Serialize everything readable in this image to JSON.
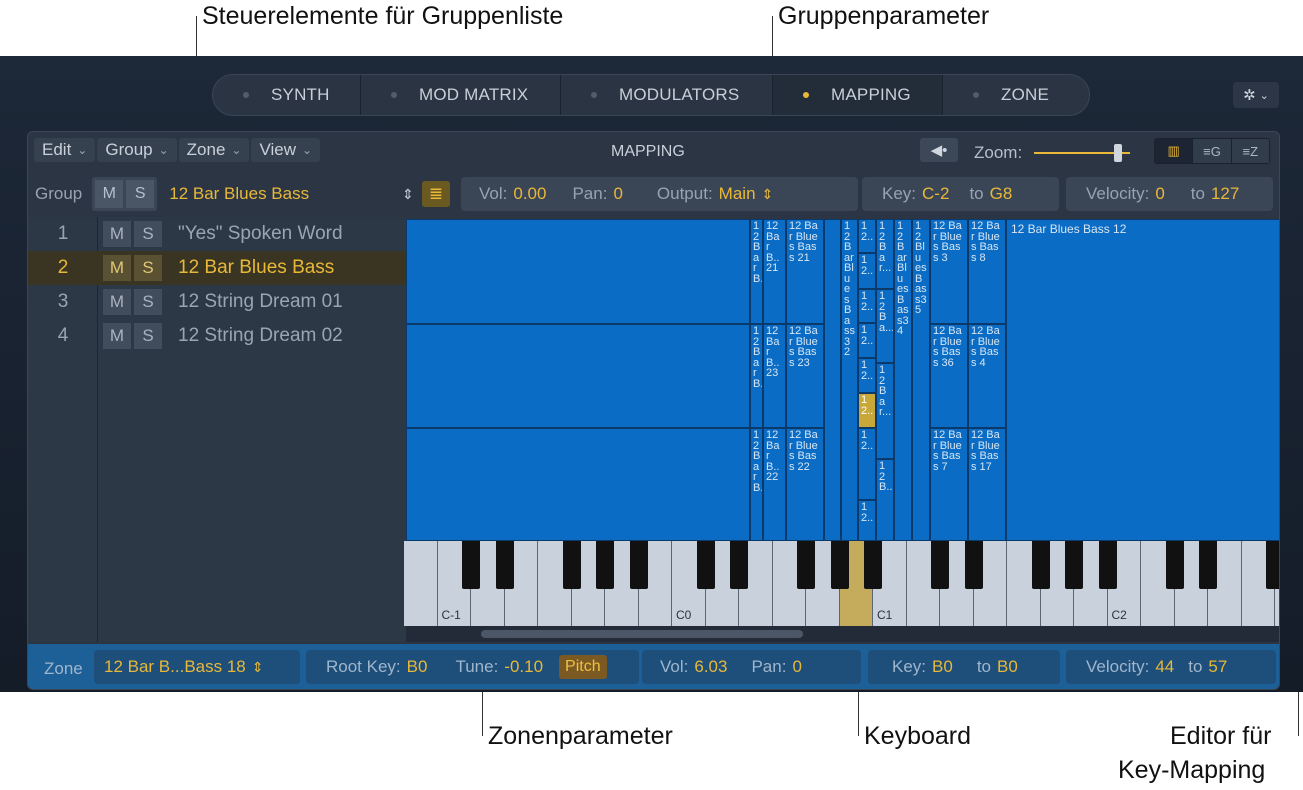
{
  "callouts": {
    "group_controls": "Steuerelemente für Gruppenliste",
    "group_params": "Gruppenparameter",
    "zone_params": "Zonenparameter",
    "keyboard": "Keyboard",
    "editor_line1": "Editor für",
    "editor_line2": "Key-Mapping"
  },
  "tabs": [
    {
      "label": "SYNTH",
      "active": false
    },
    {
      "label": "MOD MATRIX",
      "active": false
    },
    {
      "label": "MODULATORS",
      "active": false
    },
    {
      "label": "MAPPING",
      "active": true
    },
    {
      "label": "ZONE",
      "active": false
    }
  ],
  "menus": {
    "edit": "Edit",
    "group": "Group",
    "zone": "Zone",
    "view": "View"
  },
  "mapping_title": "MAPPING",
  "zoom_label": "Zoom:",
  "view_buttons": [
    "keyboard-view",
    "group-view",
    "zone-view"
  ],
  "group_bar": {
    "label": "Group",
    "m": "M",
    "s": "S",
    "selected_group": "12 Bar Blues Bass",
    "vol_label": "Vol:",
    "vol": "0.00",
    "pan_label": "Pan:",
    "pan": "0",
    "output_label": "Output:",
    "output": "Main",
    "key_label": "Key:",
    "key_low": "C-2",
    "to_label": "to",
    "key_high": "G8",
    "vel_label": "Velocity:",
    "vel_low": "0",
    "vel_to": "to",
    "vel_high": "127"
  },
  "groups": [
    {
      "num": "1",
      "m": "M",
      "s": "S",
      "name": "\"Yes\" Spoken Word"
    },
    {
      "num": "2",
      "m": "M",
      "s": "S",
      "name": "12 Bar Blues Bass"
    },
    {
      "num": "3",
      "m": "M",
      "s": "S",
      "name": "12 String Dream 01"
    },
    {
      "num": "4",
      "m": "M",
      "s": "S",
      "name": "12 String Dream 02"
    }
  ],
  "zones_text": {
    "z1": "12BarB..",
    "z2": "12BarB..21",
    "z3": "12 Bar Blue s Bass 21",
    "z4": "12BarB..",
    "z5": "12BarB..23",
    "z6": "12 Bar Blue s Bass 23",
    "z7": "12BarB..",
    "z8": "12BarB..22",
    "z9": "12 Bar Blue s Bass 22",
    "c1": "12BarBluesBass32",
    "c2": "12..",
    "c3": "12..",
    "c4": "12..",
    "c5": "12..",
    "c6": "12..",
    "c7": "12..",
    "c8": "12..",
    "c9": "12..",
    "d1": "12Bar...",
    "d2": "12Ba...",
    "d3": "12Bar...",
    "d4": "12B...",
    "e1": "12BarBluesBass34",
    "f1": "12BluesBass35",
    "g1": "12 Bar Blue s Bass 3",
    "g2": "12 Bar Blue s Bass 36",
    "g3": "12 Bar Blue s Bass 7",
    "h1": "12 Bar Blue s Bass 8",
    "h2": "12 Bar Blue s Bass 4",
    "h3": "12 Bar Blue s Bass 17",
    "big": "12 Bar Blues Bass 12"
  },
  "keyboard_labels": [
    "C-1",
    "C0",
    "C1",
    "C2"
  ],
  "zone_bar": {
    "label": "Zone",
    "zone": "12 Bar B...Bass 18",
    "root_label": "Root Key:",
    "root": "B0",
    "tune_label": "Tune:",
    "tune": "-0.10",
    "pitch": "Pitch",
    "vol_label": "Vol:",
    "vol": "6.03",
    "pan_label": "Pan:",
    "pan": "0",
    "key_label": "Key:",
    "key_low": "B0",
    "to_label": "to",
    "key_high": "B0",
    "vel_label": "Velocity:",
    "vel_low": "44",
    "vel_to": "to",
    "vel_high": "57"
  },
  "colors": {
    "accent": "#e8b838",
    "editor_blue": "#0a6cc4",
    "zone_bar": "#1d5f97"
  }
}
